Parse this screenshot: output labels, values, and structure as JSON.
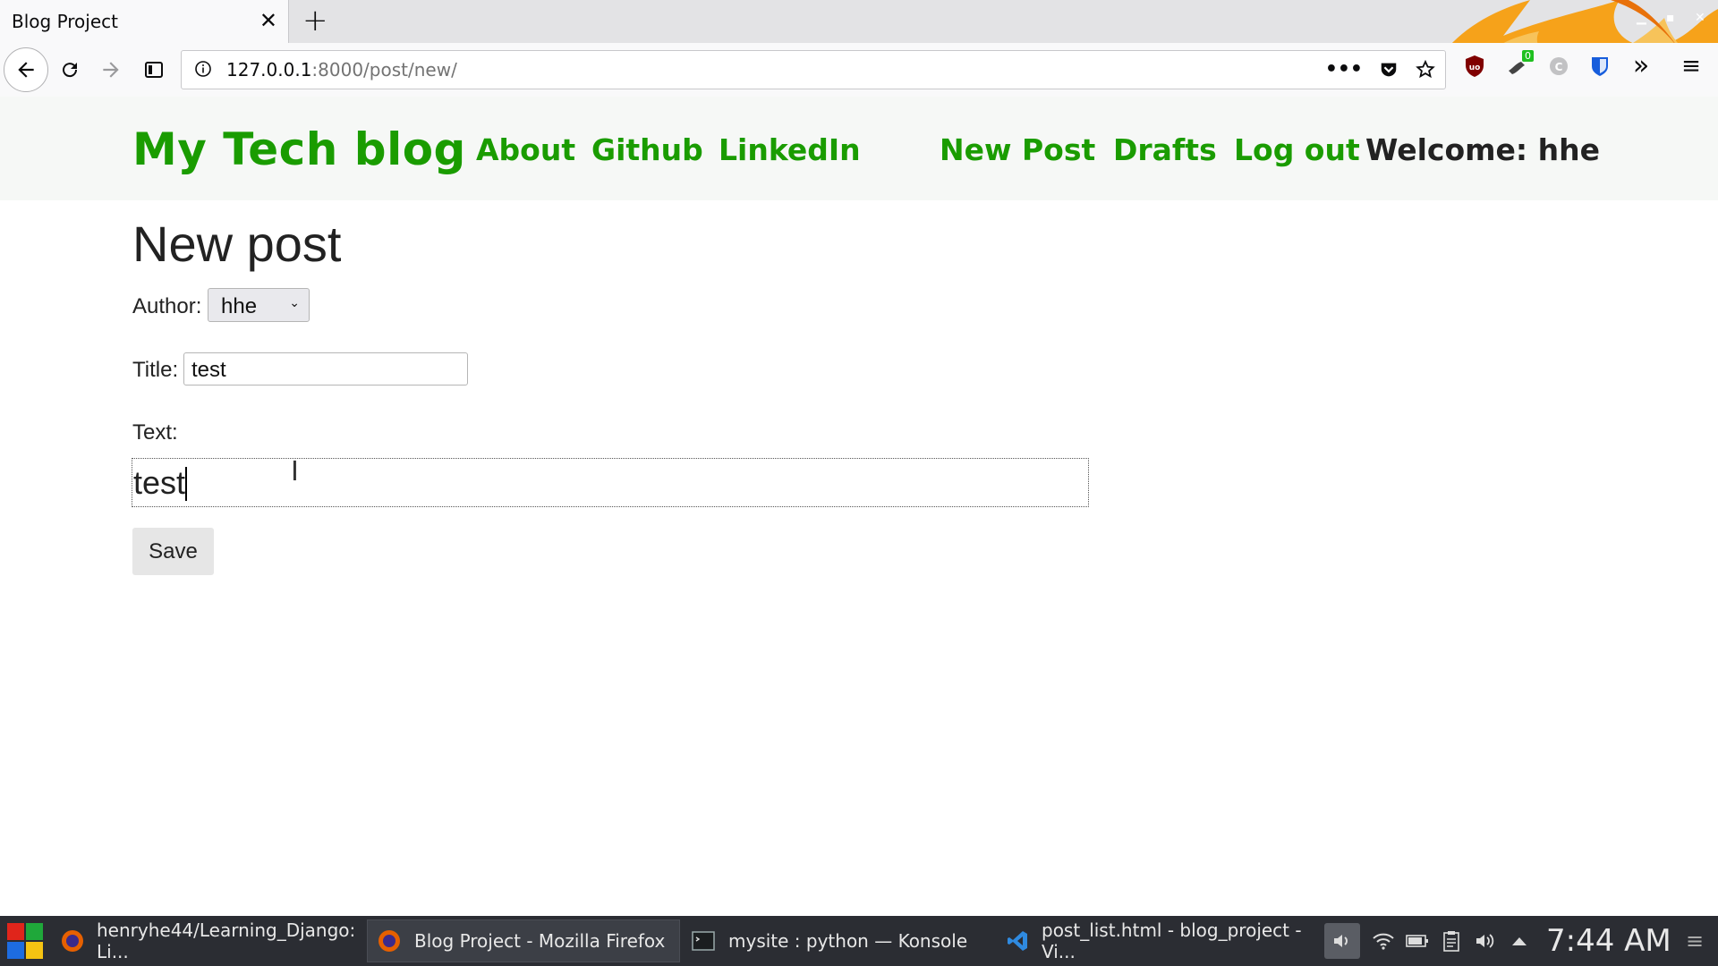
{
  "browser": {
    "tab_title": "Blog Project",
    "url_host": "127.0.0.1",
    "url_rest": ":8000/post/new/",
    "ublock_badge": "0"
  },
  "site": {
    "brand": "My Tech blog",
    "nav_links": [
      "About",
      "Github",
      "LinkedIn"
    ],
    "right_links": [
      "New Post",
      "Drafts",
      "Log out"
    ],
    "welcome": "Welcome: hhe",
    "accent_color": "#1a9c00"
  },
  "form": {
    "heading": "New post",
    "author_label": "Author:",
    "author_value": "hhe",
    "title_label": "Title:",
    "title_value": "test",
    "text_label": "Text:",
    "text_value": "test",
    "save_label": "Save"
  },
  "taskbar": {
    "tasks": [
      "henryhe44/Learning_Django: Li...",
      "Blog Project - Mozilla Firefox",
      "mysite : python — Konsole",
      "post_list.html - blog_project - Vi..."
    ],
    "clock": "7:44 AM"
  }
}
